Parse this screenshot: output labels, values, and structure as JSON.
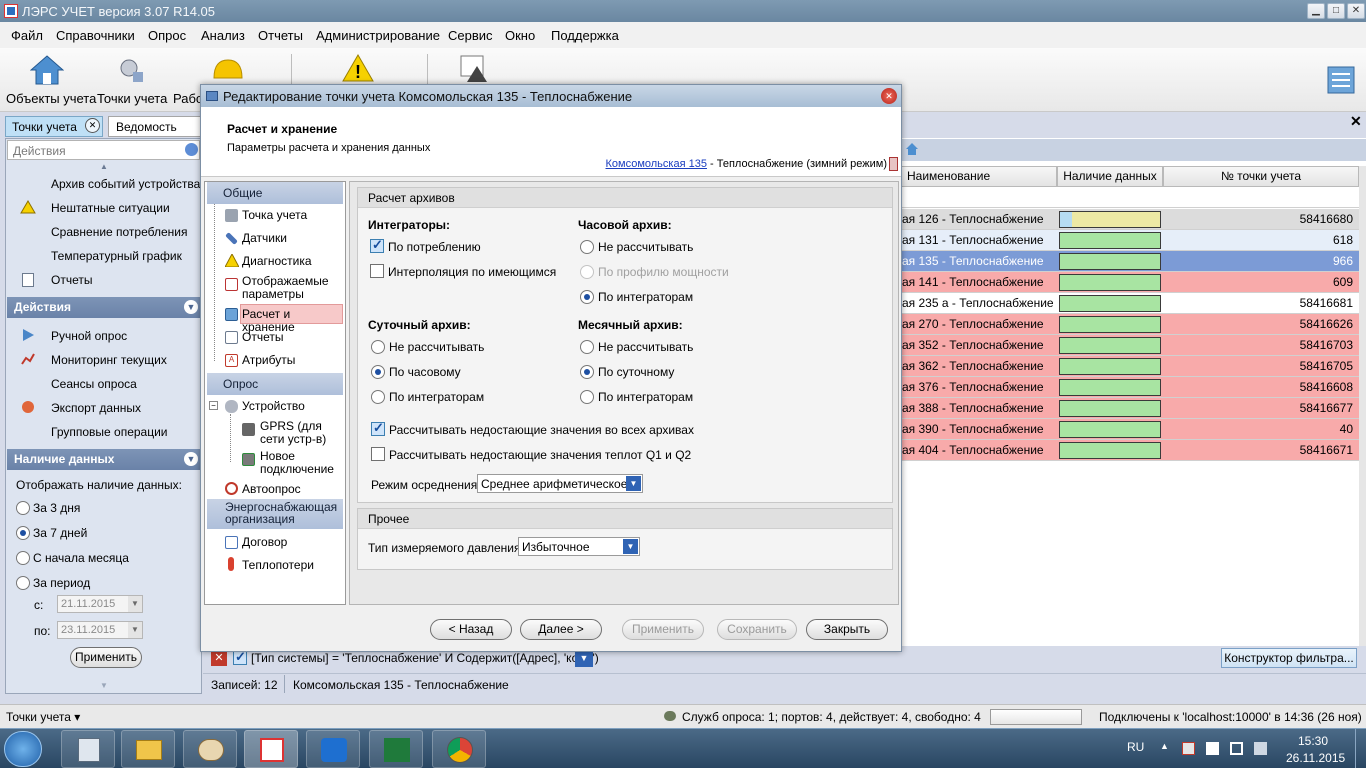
{
  "app": {
    "title": "ЛЭРС УЧЕТ версия 3.07 R14.05"
  },
  "menu": [
    "Файл",
    "Справочники",
    "Опрос",
    "Анализ",
    "Отчеты",
    "Администрирование",
    "Сервис",
    "Окно",
    "Поддержка"
  ],
  "toolbar": {
    "objects": "Объекты учета",
    "points": "Точки учета",
    "work": "Рабо"
  },
  "tabs": {
    "points": "Точки учета",
    "statement": "Ведомость парам"
  },
  "left_panel": {
    "search_placeholder": "Действия",
    "items_top": [
      "Архив событий устройства",
      "Нештатные ситуации",
      "Сравнение потребления",
      "Температурный график",
      "Отчеты"
    ],
    "actions_title": "Действия",
    "actions": [
      "Ручной опрос",
      "Мониторинг текущих",
      "Сеансы опроса",
      "Экспорт данных",
      "Групповые операции"
    ],
    "availability_title": "Наличие данных",
    "show_label": "Отображать наличие данных:",
    "options": [
      "За 3 дня",
      "За 7 дней",
      "С начала месяца",
      "За период"
    ],
    "selected_option": 1,
    "from_label": "с:",
    "from_value": "21.11.2015",
    "to_label": "по:",
    "to_value": "23.11.2015",
    "apply": "Применить"
  },
  "grid": {
    "headers": [
      "Наименование",
      "Наличие данных",
      "№ точки учета"
    ],
    "rows": [
      {
        "name": "ая 126 - Теплоснабжение",
        "number": "58416680",
        "state": "partial",
        "bg": "#dcdcdc"
      },
      {
        "name": "ая 131 - Теплоснабжение",
        "number": "618",
        "state": "full",
        "bg": "#e6eef9"
      },
      {
        "name": "ая 135 - Теплоснабжение",
        "number": "966",
        "state": "full",
        "bg": "#7c9bd6"
      },
      {
        "name": "ая 141 - Теплоснабжение",
        "number": "609",
        "state": "full",
        "bg": "#f8aaaa"
      },
      {
        "name": "ая 235 а - Теплоснабжение",
        "number": "58416681",
        "state": "full",
        "bg": "#ffffff"
      },
      {
        "name": "ая 270 - Теплоснабжение",
        "number": "58416626",
        "state": "full",
        "bg": "#f8aaaa"
      },
      {
        "name": "ая 352 - Теплоснабжение",
        "number": "58416703",
        "state": "full",
        "bg": "#f8aaaa"
      },
      {
        "name": "ая 362 - Теплоснабжение",
        "number": "58416705",
        "state": "full",
        "bg": "#f8aaaa"
      },
      {
        "name": "ая 376 - Теплоснабжение",
        "number": "58416608",
        "state": "full",
        "bg": "#f8aaaa"
      },
      {
        "name": "ая 388 - Теплоснабжение",
        "number": "58416677",
        "state": "full",
        "bg": "#f8aaaa"
      },
      {
        "name": "ая 390 - Теплоснабжение",
        "number": "40",
        "state": "full",
        "bg": "#f8aaaa"
      },
      {
        "name": "ая 404 - Теплоснабжение",
        "number": "58416671",
        "state": "full",
        "bg": "#f8aaaa"
      }
    ],
    "filter_text": "[Тип системы] = 'Теплоснабжение' И Содержит([Адрес], 'комс')",
    "filter_builder": "Конструктор фильтра..."
  },
  "records_bar": {
    "count": "Записей: 12",
    "current": "Комсомольская 135 - Теплоснабжение"
  },
  "dialog": {
    "title": "Редактирование точки учета Комсомольская 135 - Теплоснабжение",
    "header_title": "Расчет и хранение",
    "header_sub": "Параметры расчета и хранения данных",
    "link": "Комсомольская 135",
    "link_suffix": " - Теплоснабжение (зимний режим)",
    "nav": {
      "general": "Общие",
      "general_items": [
        "Точка учета",
        "Датчики",
        "Диагностика",
        "Отображаемые параметры",
        "Расчет и хранение",
        "Отчеты",
        "Атрибуты"
      ],
      "poll": "Опрос",
      "device": "Устройство",
      "gprs": "GPRS (для сети устр-в)",
      "new_conn": "Новое подключение",
      "autopoll": "Автоопрос",
      "supplier": "Энергоснабжающая организация",
      "supplier_items": [
        "Договор",
        "Теплопотери"
      ]
    },
    "calc": {
      "group": "Расчет архивов",
      "integrators": "Интеграторы:",
      "by_consumption": "По потреблению",
      "interpolation": "Интерполяция по имеющимся",
      "hourly": "Часовой архив:",
      "hourly_opts": [
        "Не рассчитывать",
        "По профилю мощности",
        "По интеграторам"
      ],
      "daily": "Суточный архив:",
      "daily_opts": [
        "Не рассчитывать",
        "По часовому",
        "По интеграторам"
      ],
      "monthly": "Месячный архив:",
      "monthly_opts": [
        "Не рассчитывать",
        "По суточному",
        "По интеграторам"
      ],
      "missing_all": "Рассчитывать недостающие значения во всех архивах",
      "missing_q": "Рассчитывать недостающие значения теплот Q1 и Q2",
      "avg_label": "Режим осреднения:",
      "avg_value": "Среднее арифметическое"
    },
    "other": {
      "group": "Прочее",
      "pressure_label": "Тип измеряемого давления:",
      "pressure_value": "Избыточное"
    },
    "buttons": {
      "back": "< Назад",
      "next": "Далее >",
      "apply": "Применить",
      "save": "Сохранить",
      "close": "Закрыть"
    }
  },
  "status": {
    "left": "Точки учета ▾",
    "services": "Служб опроса: 1; портов: 4, действует: 4, свободно: 4",
    "connected": "Подключены к 'localhost:10000' в 14:36 (26 ноя)"
  },
  "tray": {
    "lang": "RU",
    "time": "15:30",
    "date": "26.11.2015"
  },
  "colors": {
    "full": "#a8e4a2",
    "partial_fill": "#b6dcf2",
    "partial_rest": "#ede9a4"
  }
}
